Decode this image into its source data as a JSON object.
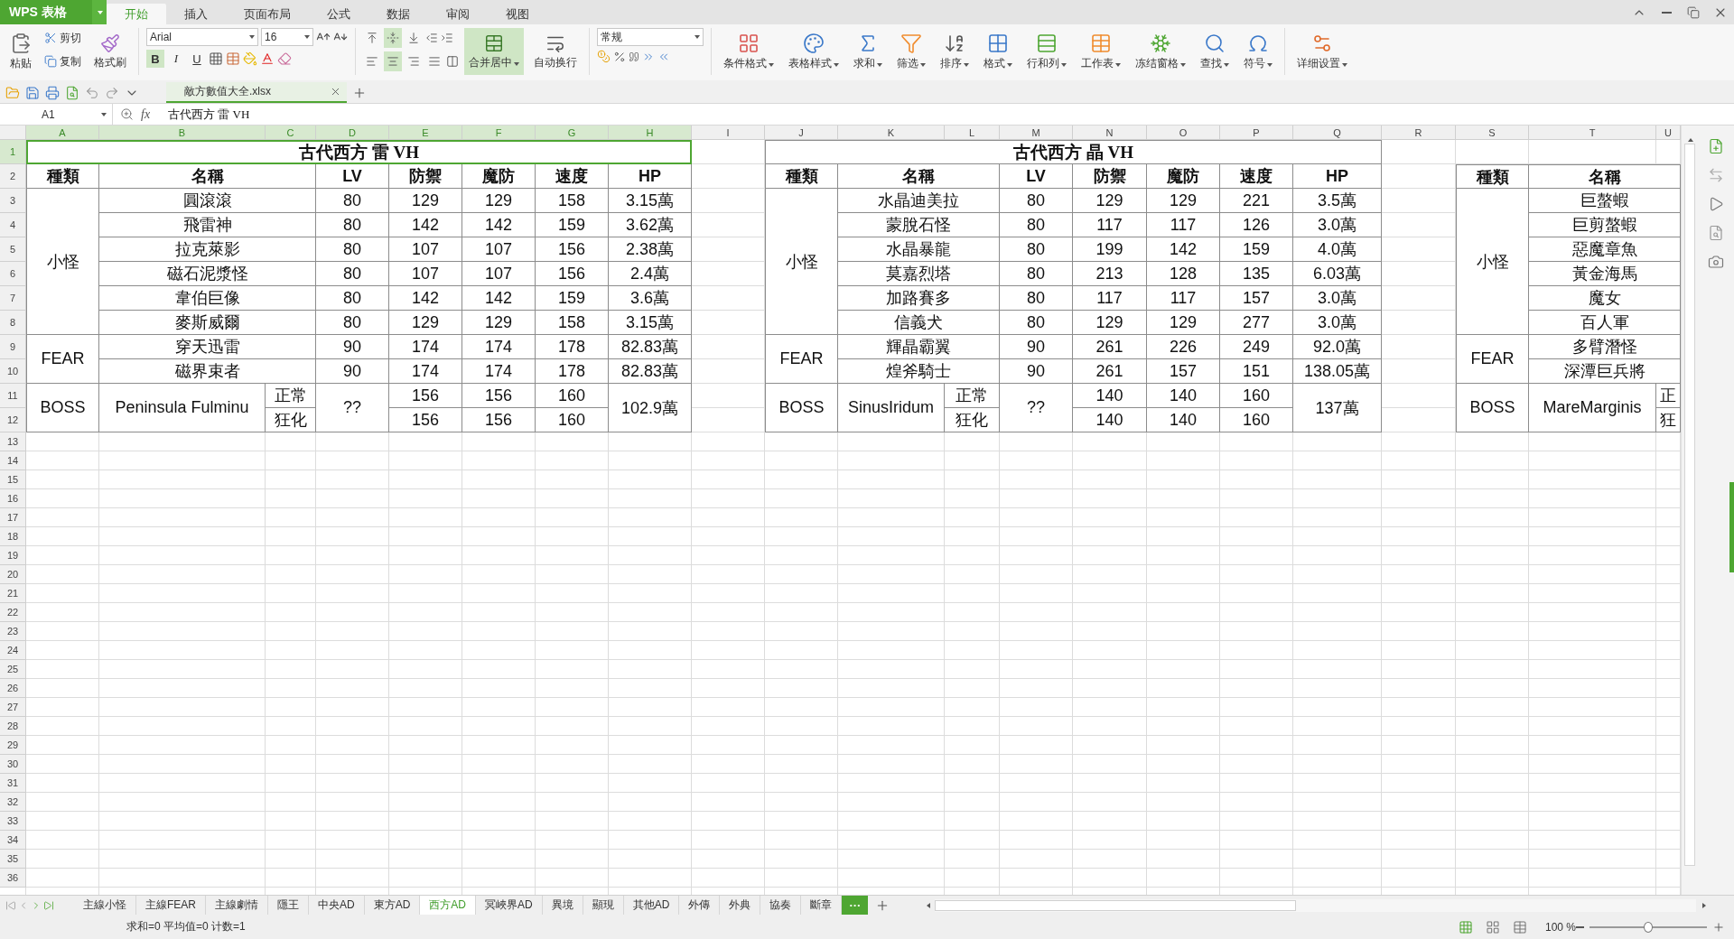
{
  "app": {
    "logo": "WPS 表格"
  },
  "menu_tabs": [
    {
      "label": "开始",
      "selected": true
    },
    {
      "label": "插入",
      "selected": false
    },
    {
      "label": "页面布局",
      "selected": false
    },
    {
      "label": "公式",
      "selected": false
    },
    {
      "label": "数据",
      "selected": false
    },
    {
      "label": "审阅",
      "selected": false
    },
    {
      "label": "视图",
      "selected": false
    }
  ],
  "ribbon": {
    "paste": "粘贴",
    "cut": "剪切",
    "copy": "复制",
    "format_painter": "格式刷",
    "font_name": "Arial",
    "font_size": "16",
    "styles": [
      {
        "label": "B",
        "selected": true
      },
      {
        "label": "I",
        "selected": false
      },
      {
        "label": "U",
        "selected": false
      }
    ],
    "vertical_align": [
      {
        "selected": false
      },
      {
        "selected": true
      },
      {
        "selected": false
      }
    ],
    "horizontal_align": [
      {
        "selected": false
      },
      {
        "selected": true
      },
      {
        "selected": false
      },
      {
        "selected": false
      }
    ],
    "merge": {
      "label": "合并居中",
      "selected": true
    },
    "wrap": {
      "label": "自动换行",
      "selected": false
    },
    "number_format": "常规",
    "tools": [
      "条件格式",
      "表格样式",
      "求和",
      "筛选",
      "排序",
      "格式",
      "行和列",
      "工作表",
      "冻结窗格",
      "查找",
      "符号",
      "详细设置"
    ]
  },
  "document_tab": {
    "title": "敵方數值大全.xlsx"
  },
  "formula_bar": {
    "cell": "A1",
    "fx": "fx",
    "content": "古代西方 雷 VH"
  },
  "columns": [
    {
      "label": "A",
      "selected": true
    },
    {
      "label": "B",
      "selected": true
    },
    {
      "label": "C",
      "selected": true
    },
    {
      "label": "D",
      "selected": true
    },
    {
      "label": "E",
      "selected": true
    },
    {
      "label": "F",
      "selected": true
    },
    {
      "label": "G",
      "selected": true
    },
    {
      "label": "H",
      "selected": true
    },
    {
      "label": "I",
      "selected": false
    },
    {
      "label": "J",
      "selected": false
    },
    {
      "label": "K",
      "selected": false
    },
    {
      "label": "L",
      "selected": false
    },
    {
      "label": "M",
      "selected": false
    },
    {
      "label": "N",
      "selected": false
    },
    {
      "label": "O",
      "selected": false
    },
    {
      "label": "P",
      "selected": false
    },
    {
      "label": "Q",
      "selected": false
    },
    {
      "label": "R",
      "selected": false
    },
    {
      "label": "S",
      "selected": false
    },
    {
      "label": "T",
      "selected": false
    },
    {
      "label": "U",
      "selected": false
    }
  ],
  "rows": [
    {
      "label": "1",
      "selected": true
    },
    {
      "label": "2",
      "selected": false
    },
    {
      "label": "3",
      "selected": false
    },
    {
      "label": "4",
      "selected": false
    },
    {
      "label": "5",
      "selected": false
    },
    {
      "label": "6",
      "selected": false
    },
    {
      "label": "7",
      "selected": false
    },
    {
      "label": "8",
      "selected": false
    },
    {
      "label": "9",
      "selected": false
    },
    {
      "label": "10",
      "selected": false
    },
    {
      "label": "11",
      "selected": false
    },
    {
      "label": "12",
      "selected": false
    },
    {
      "label": "13",
      "selected": false
    },
    {
      "label": "14",
      "selected": false
    },
    {
      "label": "15",
      "selected": false
    },
    {
      "label": "16",
      "selected": false
    },
    {
      "label": "17",
      "selected": false
    },
    {
      "label": "18",
      "selected": false
    },
    {
      "label": "19",
      "selected": false
    },
    {
      "label": "20",
      "selected": false
    },
    {
      "label": "21",
      "selected": false
    },
    {
      "label": "22",
      "selected": false
    },
    {
      "label": "23",
      "selected": false
    },
    {
      "label": "24",
      "selected": false
    },
    {
      "label": "25",
      "selected": false
    },
    {
      "label": "26",
      "selected": false
    },
    {
      "label": "27",
      "selected": false
    },
    {
      "label": "28",
      "selected": false
    },
    {
      "label": "29",
      "selected": false
    },
    {
      "label": "30",
      "selected": false
    },
    {
      "label": "31",
      "selected": false
    },
    {
      "label": "32",
      "selected": false
    },
    {
      "label": "33",
      "selected": false
    },
    {
      "label": "34",
      "selected": false
    },
    {
      "label": "35",
      "selected": false
    },
    {
      "label": "36",
      "selected": false
    }
  ],
  "tables": [
    {
      "title": {
        "text": "古代西方 雷 VH",
        "selected": true
      },
      "headers": [
        "種類",
        "名稱",
        "LV",
        "防禦",
        "魔防",
        "速度",
        "HP"
      ],
      "groups": [
        {
          "kind": "regular",
          "label": "小怪",
          "rows": [
            {
              "name": "圓滾滾",
              "values": [
                "80",
                "129",
                "129",
                "158",
                "3.15萬"
              ]
            },
            {
              "name": "飛雷神",
              "values": [
                "80",
                "142",
                "142",
                "159",
                "3.62萬"
              ]
            },
            {
              "name": "拉克萊影",
              "values": [
                "80",
                "107",
                "107",
                "156",
                "2.38萬"
              ]
            },
            {
              "name": "磁石泥漿怪",
              "values": [
                "80",
                "107",
                "107",
                "156",
                "2.4萬"
              ]
            },
            {
              "name": "韋伯巨像",
              "values": [
                "80",
                "142",
                "142",
                "159",
                "3.6萬"
              ]
            },
            {
              "name": "麥斯威爾",
              "values": [
                "80",
                "129",
                "129",
                "158",
                "3.15萬"
              ]
            }
          ]
        },
        {
          "kind": "regular",
          "label": "FEAR",
          "rows": [
            {
              "name": "穿天迅雷",
              "values": [
                "90",
                "174",
                "174",
                "178",
                "82.83萬"
              ]
            },
            {
              "name": "磁界束者",
              "values": [
                "90",
                "174",
                "174",
                "178",
                "82.83萬"
              ]
            }
          ]
        },
        {
          "kind": "boss",
          "label": "BOSS",
          "name": "Peninsula Fulminu",
          "modes": [
            "正常",
            "狂化"
          ],
          "lv": "??",
          "stats": [
            [
              "156",
              "156",
              "160"
            ],
            [
              "156",
              "156",
              "160"
            ]
          ],
          "hp": "102.9萬"
        }
      ]
    },
    {
      "title": {
        "text": "古代西方 晶 VH",
        "selected": false
      },
      "headers": [
        "種類",
        "名稱",
        "LV",
        "防禦",
        "魔防",
        "速度",
        "HP"
      ],
      "groups": [
        {
          "kind": "regular",
          "label": "小怪",
          "rows": [
            {
              "name": "水晶迪美拉",
              "values": [
                "80",
                "129",
                "129",
                "221",
                "3.5萬"
              ]
            },
            {
              "name": "蒙脫石怪",
              "values": [
                "80",
                "117",
                "117",
                "126",
                "3.0萬"
              ]
            },
            {
              "name": "水晶暴龍",
              "values": [
                "80",
                "199",
                "142",
                "159",
                "4.0萬"
              ]
            },
            {
              "name": "莫嘉烈塔",
              "values": [
                "80",
                "213",
                "128",
                "135",
                "6.03萬"
              ]
            },
            {
              "name": "加路賽多",
              "values": [
                "80",
                "117",
                "117",
                "157",
                "3.0萬"
              ]
            },
            {
              "name": "信義犬",
              "values": [
                "80",
                "129",
                "129",
                "277",
                "3.0萬"
              ]
            }
          ]
        },
        {
          "kind": "regular",
          "label": "FEAR",
          "rows": [
            {
              "name": "輝晶霸翼",
              "values": [
                "90",
                "261",
                "226",
                "249",
                "92.0萬"
              ]
            },
            {
              "name": "煌斧騎士",
              "values": [
                "90",
                "261",
                "157",
                "151",
                "138.05萬"
              ]
            }
          ]
        },
        {
          "kind": "boss",
          "label": "BOSS",
          "name": "SinusIridum",
          "modes": [
            "正常",
            "狂化"
          ],
          "lv": "??",
          "stats": [
            [
              "140",
              "140",
              "160"
            ],
            [
              "140",
              "140",
              "160"
            ]
          ],
          "hp": "137萬"
        }
      ]
    },
    {
      "headers": [
        "種類",
        "名稱"
      ],
      "groups": [
        {
          "kind": "regular",
          "label": "小怪",
          "rows": [
            {
              "name": "巨螯蝦"
            },
            {
              "name": "巨剪螯蝦"
            },
            {
              "name": "惡魔章魚"
            },
            {
              "name": "黃金海馬"
            },
            {
              "name": "魔女"
            },
            {
              "name": "百人軍"
            }
          ]
        },
        {
          "kind": "regular",
          "label": "FEAR",
          "rows": [
            {
              "name": "多臂潛怪"
            },
            {
              "name": "深潭巨兵將"
            }
          ]
        },
        {
          "kind": "boss",
          "label": "BOSS",
          "name": "MareMarginis",
          "modes": [
            "正",
            "狂"
          ]
        }
      ]
    }
  ],
  "sheet_tabs": [
    {
      "label": "主線小怪",
      "selected": false
    },
    {
      "label": "主線FEAR",
      "selected": false
    },
    {
      "label": "主線劇情",
      "selected": false
    },
    {
      "label": "隱王",
      "selected": false
    },
    {
      "label": "中央AD",
      "selected": false
    },
    {
      "label": "東方AD",
      "selected": false
    },
    {
      "label": "西方AD",
      "selected": true
    },
    {
      "label": "冥峽界AD",
      "selected": false
    },
    {
      "label": "異境",
      "selected": false
    },
    {
      "label": "顯現",
      "selected": false
    },
    {
      "label": "其他AD",
      "selected": false
    },
    {
      "label": "外傳",
      "selected": false
    },
    {
      "label": "外典",
      "selected": false
    },
    {
      "label": "協奏",
      "selected": false
    },
    {
      "label": "斷章",
      "selected": false
    }
  ],
  "more_tabs": "···",
  "status_bar": {
    "summary": "求和=0 平均值=0 计数=1",
    "zoom": "100 %",
    "zoom_slider": {
      "level": 0.5
    }
  }
}
